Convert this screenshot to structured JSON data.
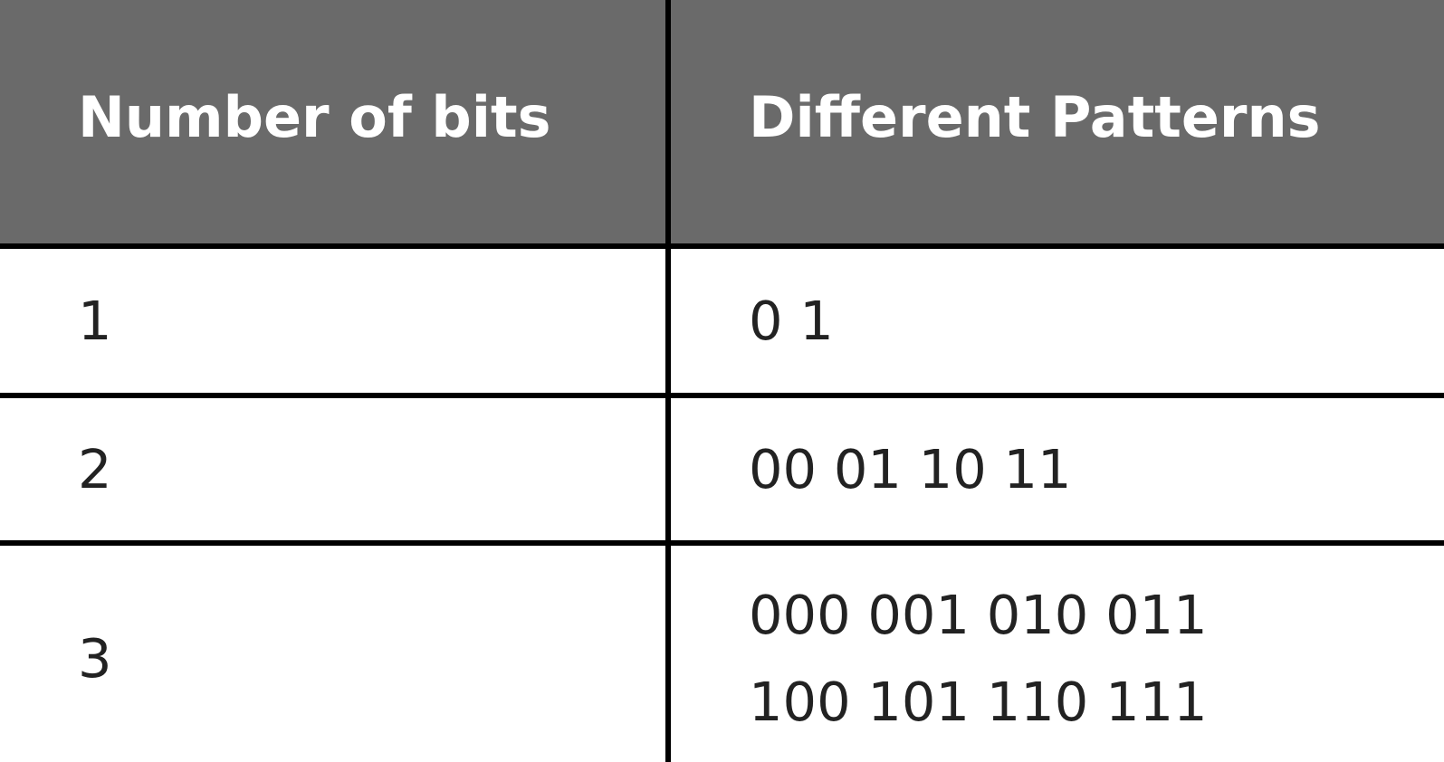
{
  "table": {
    "headers": [
      "Number of bits",
      "Different Patterns"
    ],
    "rows": [
      {
        "bits": "1",
        "patterns": [
          "0 1"
        ]
      },
      {
        "bits": "2",
        "patterns": [
          "00 01 10 11"
        ]
      },
      {
        "bits": "3",
        "patterns": [
          "000 001 010 011",
          "100 101 110 111"
        ]
      }
    ]
  },
  "colors": {
    "header_background": "#6a6a6a",
    "header_text": "#ffffff",
    "border": "#000000",
    "body_text": "#222222"
  }
}
